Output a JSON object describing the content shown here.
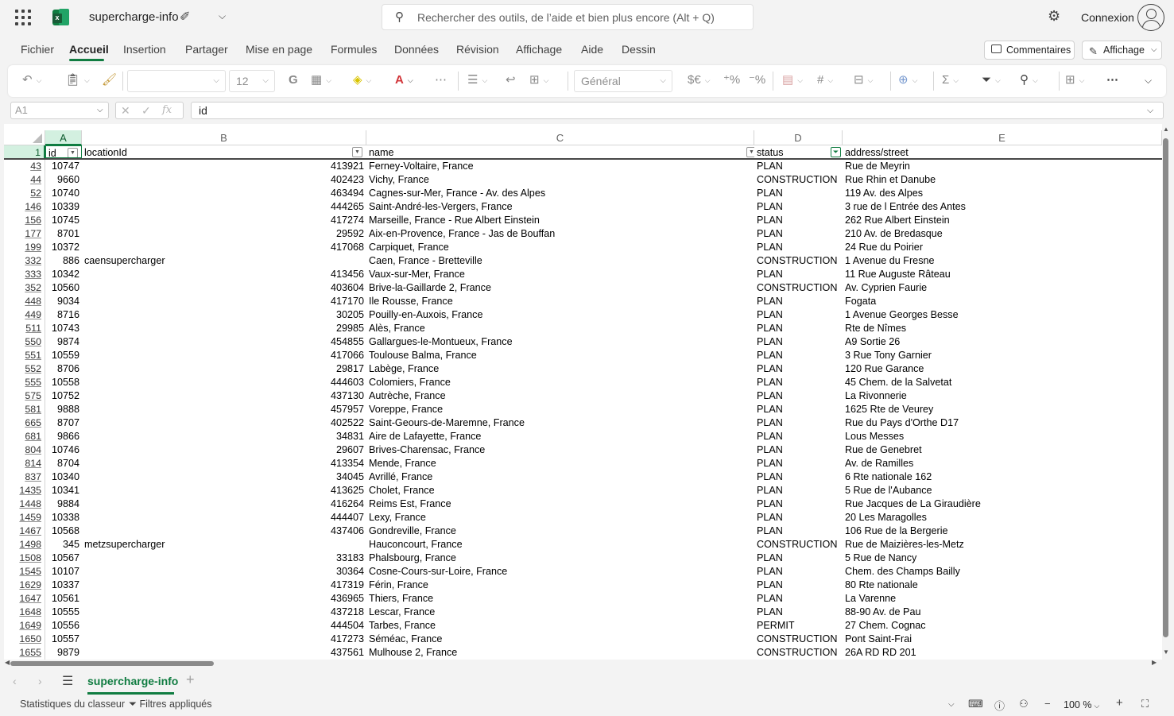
{
  "titlebar": {
    "doc_title": "supercharge-info",
    "search_placeholder": "Rechercher des outils, de l’aide et bien plus encore (Alt + Q)",
    "sign_in": "Connexion"
  },
  "menu": {
    "tabs": [
      "Fichier",
      "Accueil",
      "Insertion",
      "Partager",
      "Mise en page",
      "Formules",
      "Données",
      "Révision",
      "Affichage",
      "Aide",
      "Dessin"
    ],
    "active_tab": "Accueil",
    "comments_label": "Commentaires",
    "view_label": "Affichage"
  },
  "ribbon": {
    "font_size": "12",
    "bold_label": "G",
    "number_format": "Général"
  },
  "formula_bar": {
    "name_box": "A1",
    "fx_label": "fx",
    "formula": "id"
  },
  "grid": {
    "column_letters": [
      "A",
      "B",
      "C",
      "D",
      "E"
    ],
    "header_row_number": "1",
    "headers": [
      "id",
      "locationId",
      "name",
      "status",
      "address/street"
    ],
    "rows": [
      {
        "n": "43",
        "id": "10747",
        "loc": "413921",
        "name": "Ferney-Voltaire, France",
        "status": "PLAN",
        "street": "Rue de Meyrin"
      },
      {
        "n": "44",
        "id": "9660",
        "loc": "402423",
        "name": "Vichy, France",
        "status": "CONSTRUCTION",
        "street": "Rue Rhin et Danube"
      },
      {
        "n": "52",
        "id": "10740",
        "loc": "463494",
        "name": "Cagnes-sur-Mer, France - Av. des Alpes",
        "status": "PLAN",
        "street": "119 Av. des Alpes"
      },
      {
        "n": "146",
        "id": "10339",
        "loc": "444265",
        "name": "Saint-André-les-Vergers, France",
        "status": "PLAN",
        "street": "3 rue de l Entrée des Antes"
      },
      {
        "n": "156",
        "id": "10745",
        "loc": "417274",
        "name": "Marseille, France - Rue Albert Einstein",
        "status": "PLAN",
        "street": "262 Rue Albert Einstein"
      },
      {
        "n": "177",
        "id": "8701",
        "loc": "29592",
        "name": "Aix-en-Provence, France - Jas de Bouffan",
        "status": "PLAN",
        "street": "210 Av. de Bredasque"
      },
      {
        "n": "199",
        "id": "10372",
        "loc": "417068",
        "name": "Carpiquet, France",
        "status": "PLAN",
        "street": "24 Rue du Poirier"
      },
      {
        "n": "332",
        "id": "886",
        "loc": "caensupercharger",
        "name": "Caen, France - Bretteville",
        "status": "CONSTRUCTION",
        "street": "1 Avenue du Fresne"
      },
      {
        "n": "333",
        "id": "10342",
        "loc": "413456",
        "name": "Vaux-sur-Mer, France",
        "status": "PLAN",
        "street": "11 Rue Auguste Râteau"
      },
      {
        "n": "352",
        "id": "10560",
        "loc": "403604",
        "name": "Brive-la-Gaillarde 2, France",
        "status": "CONSTRUCTION",
        "street": "Av. Cyprien Faurie"
      },
      {
        "n": "448",
        "id": "9034",
        "loc": "417170",
        "name": "Ile Rousse, France",
        "status": "PLAN",
        "street": "Fogata"
      },
      {
        "n": "449",
        "id": "8716",
        "loc": "30205",
        "name": "Pouilly-en-Auxois, France",
        "status": "PLAN",
        "street": "1 Avenue Georges Besse"
      },
      {
        "n": "511",
        "id": "10743",
        "loc": "29985",
        "name": "Alès, France",
        "status": "PLAN",
        "street": "Rte de Nîmes"
      },
      {
        "n": "550",
        "id": "9874",
        "loc": "454855",
        "name": "Gallargues-le-Montueux, France",
        "status": "PLAN",
        "street": "A9 Sortie 26"
      },
      {
        "n": "551",
        "id": "10559",
        "loc": "417066",
        "name": "Toulouse Balma, France",
        "status": "PLAN",
        "street": "3 Rue Tony Garnier"
      },
      {
        "n": "552",
        "id": "8706",
        "loc": "29817",
        "name": "Labège, France",
        "status": "PLAN",
        "street": "120 Rue Garance"
      },
      {
        "n": "555",
        "id": "10558",
        "loc": "444603",
        "name": "Colomiers, France",
        "status": "PLAN",
        "street": "45 Chem. de la Salvetat"
      },
      {
        "n": "575",
        "id": "10752",
        "loc": "437130",
        "name": "Autrèche, France",
        "status": "PLAN",
        "street": "La Rivonnerie"
      },
      {
        "n": "581",
        "id": "9888",
        "loc": "457957",
        "name": "Voreppe, France",
        "status": "PLAN",
        "street": "1625 Rte de Veurey"
      },
      {
        "n": "665",
        "id": "8707",
        "loc": "402522",
        "name": "Saint-Geours-de-Maremne, France",
        "status": "PLAN",
        "street": "Rue du Pays d'Orthe D17"
      },
      {
        "n": "681",
        "id": "9866",
        "loc": "34831",
        "name": "Aire de Lafayette, France",
        "status": "PLAN",
        "street": "Lous Messes"
      },
      {
        "n": "804",
        "id": "10746",
        "loc": "29607",
        "name": "Brives-Charensac, France",
        "status": "PLAN",
        "street": "Rue de Genebret"
      },
      {
        "n": "814",
        "id": "8704",
        "loc": "413354",
        "name": "Mende, France",
        "status": "PLAN",
        "street": "Av. de Ramilles"
      },
      {
        "n": "837",
        "id": "10340",
        "loc": "34045",
        "name": "Avrillé, France",
        "status": "PLAN",
        "street": "6 Rte nationale 162"
      },
      {
        "n": "1435",
        "id": "10341",
        "loc": "413625",
        "name": "Cholet, France",
        "status": "PLAN",
        "street": "5 Rue de l'Aubance"
      },
      {
        "n": "1448",
        "id": "9884",
        "loc": "416264",
        "name": "Reims Est, France",
        "status": "PLAN",
        "street": "Rue Jacques de La Giraudière"
      },
      {
        "n": "1459",
        "id": "10338",
        "loc": "444407",
        "name": "Lexy, France",
        "status": "PLAN",
        "street": "20 Les Maragolles"
      },
      {
        "n": "1467",
        "id": "10568",
        "loc": "437406",
        "name": "Gondreville, France",
        "status": "PLAN",
        "street": "106 Rue de la Bergerie"
      },
      {
        "n": "1498",
        "id": "345",
        "loc": "metzsupercharger",
        "name": "Hauconcourt, France",
        "status": "CONSTRUCTION",
        "street": "Rue de Maizières-les-Metz"
      },
      {
        "n": "1508",
        "id": "10567",
        "loc": "33183",
        "name": "Phalsbourg, France",
        "status": "PLAN",
        "street": "5 Rue de Nancy"
      },
      {
        "n": "1545",
        "id": "10107",
        "loc": "30364",
        "name": "Cosne-Cours-sur-Loire, France",
        "status": "PLAN",
        "street": "Chem. des Champs Bailly"
      },
      {
        "n": "1629",
        "id": "10337",
        "loc": "417319",
        "name": "Férin, France",
        "status": "PLAN",
        "street": "80 Rte nationale"
      },
      {
        "n": "1647",
        "id": "10561",
        "loc": "436965",
        "name": "Thiers, France",
        "status": "PLAN",
        "street": "La Varenne"
      },
      {
        "n": "1648",
        "id": "10555",
        "loc": "437218",
        "name": "Lescar, France",
        "status": "PLAN",
        "street": "88-90 Av. de Pau"
      },
      {
        "n": "1649",
        "id": "10556",
        "loc": "444504",
        "name": "Tarbes, France",
        "status": "PERMIT",
        "street": "27 Chem. Cognac"
      },
      {
        "n": "1650",
        "id": "10557",
        "loc": "417273",
        "name": "Séméac, France",
        "status": "CONSTRUCTION",
        "street": "Pont Saint-Frai"
      },
      {
        "n": "1655",
        "id": "9879",
        "loc": "437561",
        "name": "Mulhouse 2, France",
        "status": "CONSTRUCTION",
        "street": "26A RD RD 201"
      }
    ]
  },
  "sheets": {
    "active": "supercharge-info"
  },
  "statusbar": {
    "workbook_stats": "Statistiques du classeur",
    "filters_applied": "Filtres appliqués",
    "zoom": "100 %"
  },
  "colors": {
    "accent": "#107c41",
    "selected_header_bg": "#d3f0e0"
  }
}
